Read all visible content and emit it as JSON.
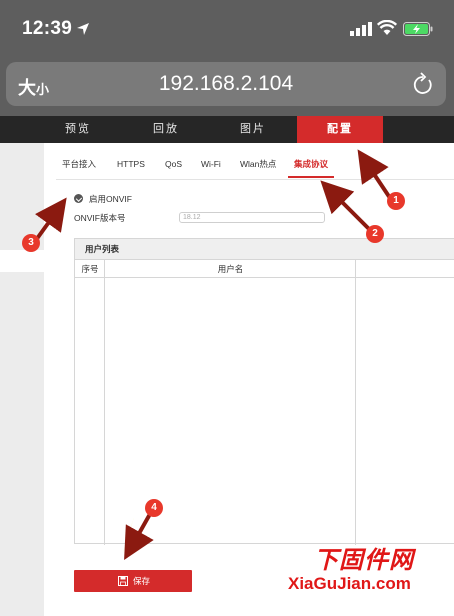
{
  "status_bar": {
    "time": "12:39"
  },
  "browser": {
    "text_size_big": "大",
    "text_size_small": "小",
    "url": "192.168.2.104"
  },
  "main_nav": [
    {
      "label": "预览",
      "active": false
    },
    {
      "label": "回放",
      "active": false
    },
    {
      "label": "图片",
      "active": false
    },
    {
      "label": "配置",
      "active": true
    }
  ],
  "sub_tabs": [
    {
      "label": "平台接入",
      "active": false
    },
    {
      "label": "HTTPS",
      "active": false
    },
    {
      "label": "QoS",
      "active": false
    },
    {
      "label": "Wi-Fi",
      "active": false
    },
    {
      "label": "Wlan热点",
      "active": false
    },
    {
      "label": "集成协议",
      "active": true
    }
  ],
  "onvif": {
    "enable_label": "启用ONVIF",
    "enabled": true,
    "version_label": "ONVIF版本号",
    "version_value": "18.12"
  },
  "user_list": {
    "title": "用户列表",
    "columns": {
      "no": "序号",
      "username": "用户名"
    }
  },
  "save_button": {
    "label": "保存"
  },
  "markers": [
    "1",
    "2",
    "3",
    "4"
  ],
  "watermark": {
    "cn": "下固件网",
    "en": "XiaGuJian.com"
  },
  "colors": {
    "accent": "#d42b2b",
    "nav_bg": "#262626",
    "marker": "#e8382b",
    "arrow": "#8b1a10"
  }
}
